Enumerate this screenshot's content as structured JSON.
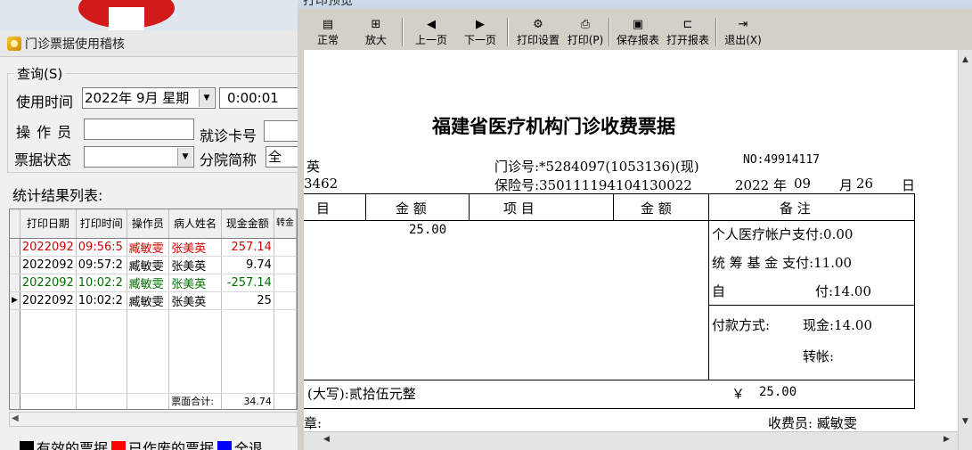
{
  "left_window": {
    "title": "门诊票据使用稽核",
    "query_label": "查询(S)",
    "use_time_label": "使用时间",
    "date_value": "2022年  9月  星期",
    "time_value": "0:00:01",
    "operator_label": "操 作 员",
    "operator_value": "",
    "card_label": "就诊卡号",
    "card_value": "",
    "status_label": "票据状态",
    "status_value": "",
    "branch_label": "分院简称",
    "branch_value": "全",
    "result_label": "统计结果列表:",
    "columns": [
      "打印日期",
      "打印时间",
      "操作员",
      "病人姓名",
      "现金金额",
      "转金"
    ],
    "rows": [
      {
        "date": "2022092",
        "time": "09:56:5",
        "operator": "臧敏雯",
        "patient": "张美英",
        "cash": "257.14",
        "style": "red"
      },
      {
        "date": "2022092",
        "time": "09:57:2",
        "operator": "臧敏雯",
        "patient": "张美英",
        "cash": "9.74",
        "style": "normal"
      },
      {
        "date": "2022092",
        "time": "10:02:2",
        "operator": "臧敏雯",
        "patient": "张美英",
        "cash": "-257.14",
        "style": "green"
      },
      {
        "date": "2022092",
        "time": "10:02:2",
        "operator": "臧敏雯",
        "patient": "张美英",
        "cash": "25",
        "style": "normal"
      }
    ],
    "sum_label": "票面合计:",
    "sum_value": "34.74",
    "legend": [
      {
        "label": "有效的票据",
        "color": "#000000"
      },
      {
        "label": "已作废的票据",
        "color": "#ff0000"
      },
      {
        "label": "全退",
        "color": "#0000ff"
      }
    ]
  },
  "preview": {
    "window_title": "打印预览",
    "toolbar": [
      {
        "label": "正常",
        "icon": "normal-view-icon",
        "glyph": "▤"
      },
      {
        "label": "放大",
        "icon": "zoom-icon",
        "glyph": "⊞"
      },
      {
        "label": "上一页",
        "icon": "prev-page-icon",
        "glyph": "◀"
      },
      {
        "label": "下一页",
        "icon": "next-page-icon",
        "glyph": "▶"
      },
      {
        "label": "打印设置",
        "icon": "print-setup-icon",
        "glyph": "⚙"
      },
      {
        "label": "打印(P)",
        "icon": "print-icon",
        "glyph": "⎙"
      },
      {
        "label": "保存报表",
        "icon": "save-icon",
        "glyph": "▣"
      },
      {
        "label": "打开报表",
        "icon": "open-folder-icon",
        "glyph": "⊏"
      },
      {
        "label": "退出(X)",
        "icon": "exit-icon",
        "glyph": "⇥"
      }
    ],
    "receipt": {
      "title": "福建省医疗机构门诊收费票据",
      "name_fragment": "英",
      "clinic_no": "门诊号:*5284097(1053136)(现)",
      "serial_no": "NO:49914117",
      "id_fragment": "3462",
      "insurance_no": "保险号:350111194104130022",
      "year": "2022 年",
      "month": "09",
      "month_label": "月",
      "day": "26",
      "day_label": "日",
      "col_item_1": "目",
      "col_amount_1": "金  额",
      "col_item_2": "项     目",
      "col_amount_2": "金  额",
      "col_remark": "备     注",
      "line_amount": "25.00",
      "personal_account": "个人医疗帐户支付:0.00",
      "pooled_fund": "统 筹 基 金 支付:11.00",
      "self_pay_label": "自",
      "self_pay_value": "付:14.00",
      "payment_method": "付款方式:",
      "cash_label": "现金:14.00",
      "transfer_label": "转帐:",
      "total_words": "(大写):贰拾伍元整",
      "total_symbol": "￥",
      "total_value": "25.00",
      "seal_fragment": "章:",
      "cashier": "收费员: 臧敏雯"
    }
  }
}
